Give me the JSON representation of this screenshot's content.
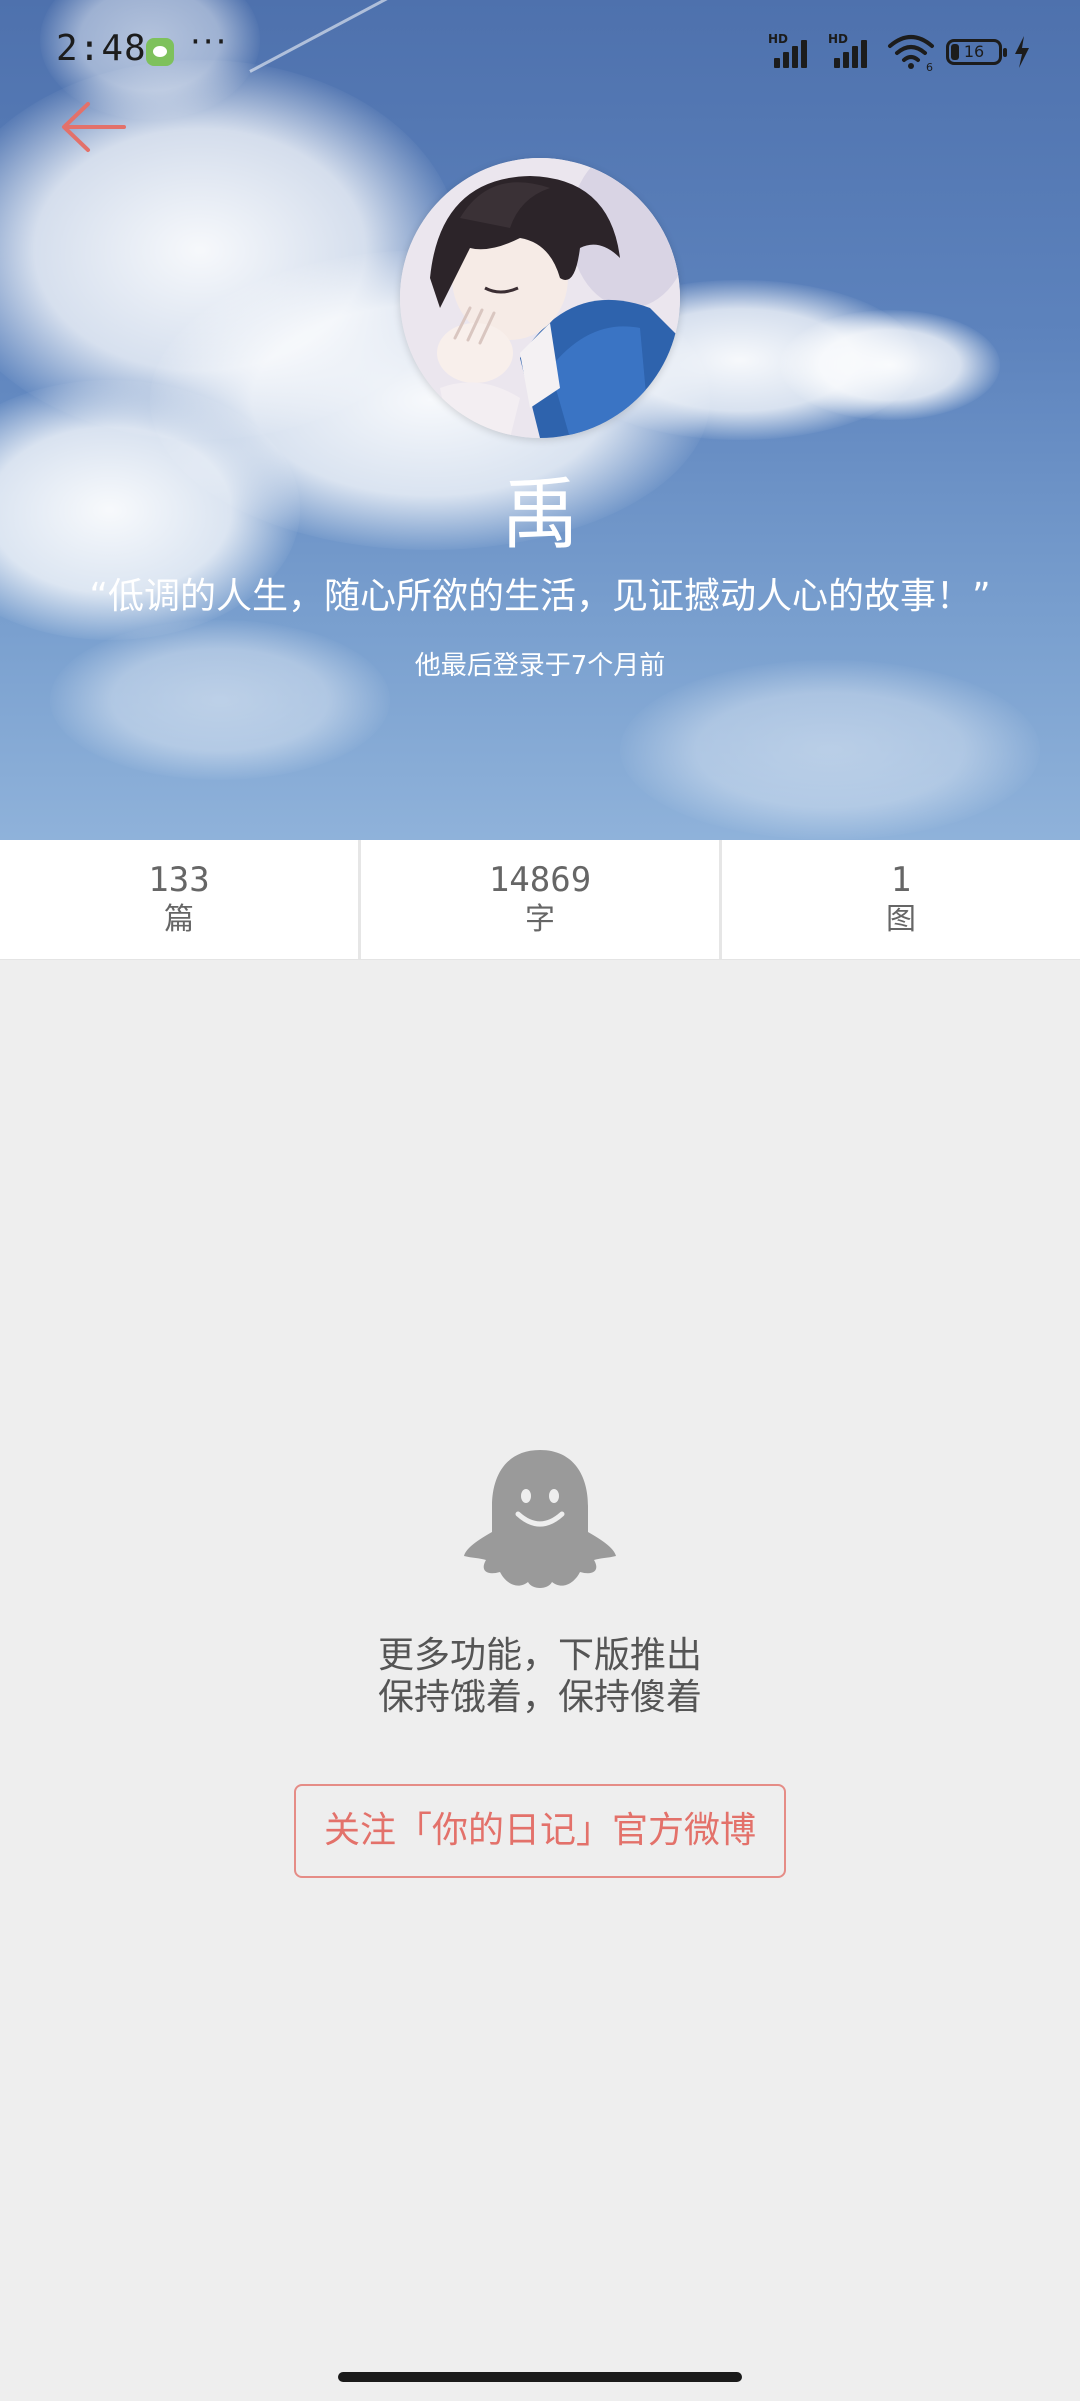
{
  "status_bar": {
    "time": "2:48",
    "more": "···",
    "battery_level": "16",
    "signal_badge": "HD",
    "wifi_badge": "6"
  },
  "profile": {
    "name": "禹",
    "motto": "“低调的人生，随心所欲的生活，见证撼动人心的故事！”",
    "last_login": "他最后登录于7个月前"
  },
  "stats": [
    {
      "value": "133",
      "label": "篇"
    },
    {
      "value": "14869",
      "label": "字"
    },
    {
      "value": "1",
      "label": "图"
    }
  ],
  "empty_state": {
    "line1": "更多功能，下版推出",
    "line2": "保持饿着，保持傻着",
    "follow_button": "关注「你的日记」官方微博"
  },
  "colors": {
    "accent": "#e3716a",
    "sky_top": "#4e71ad",
    "sky_bottom": "#8fb2da",
    "background": "#eeeeee",
    "ghost": "#9a9a9a"
  },
  "icons": {
    "back": "arrow-left-icon",
    "ghost": "ghost-icon",
    "wechat": "wechat-icon",
    "signal": "signal-icon",
    "wifi": "wifi-icon",
    "battery": "battery-icon",
    "charging": "bolt-icon"
  }
}
